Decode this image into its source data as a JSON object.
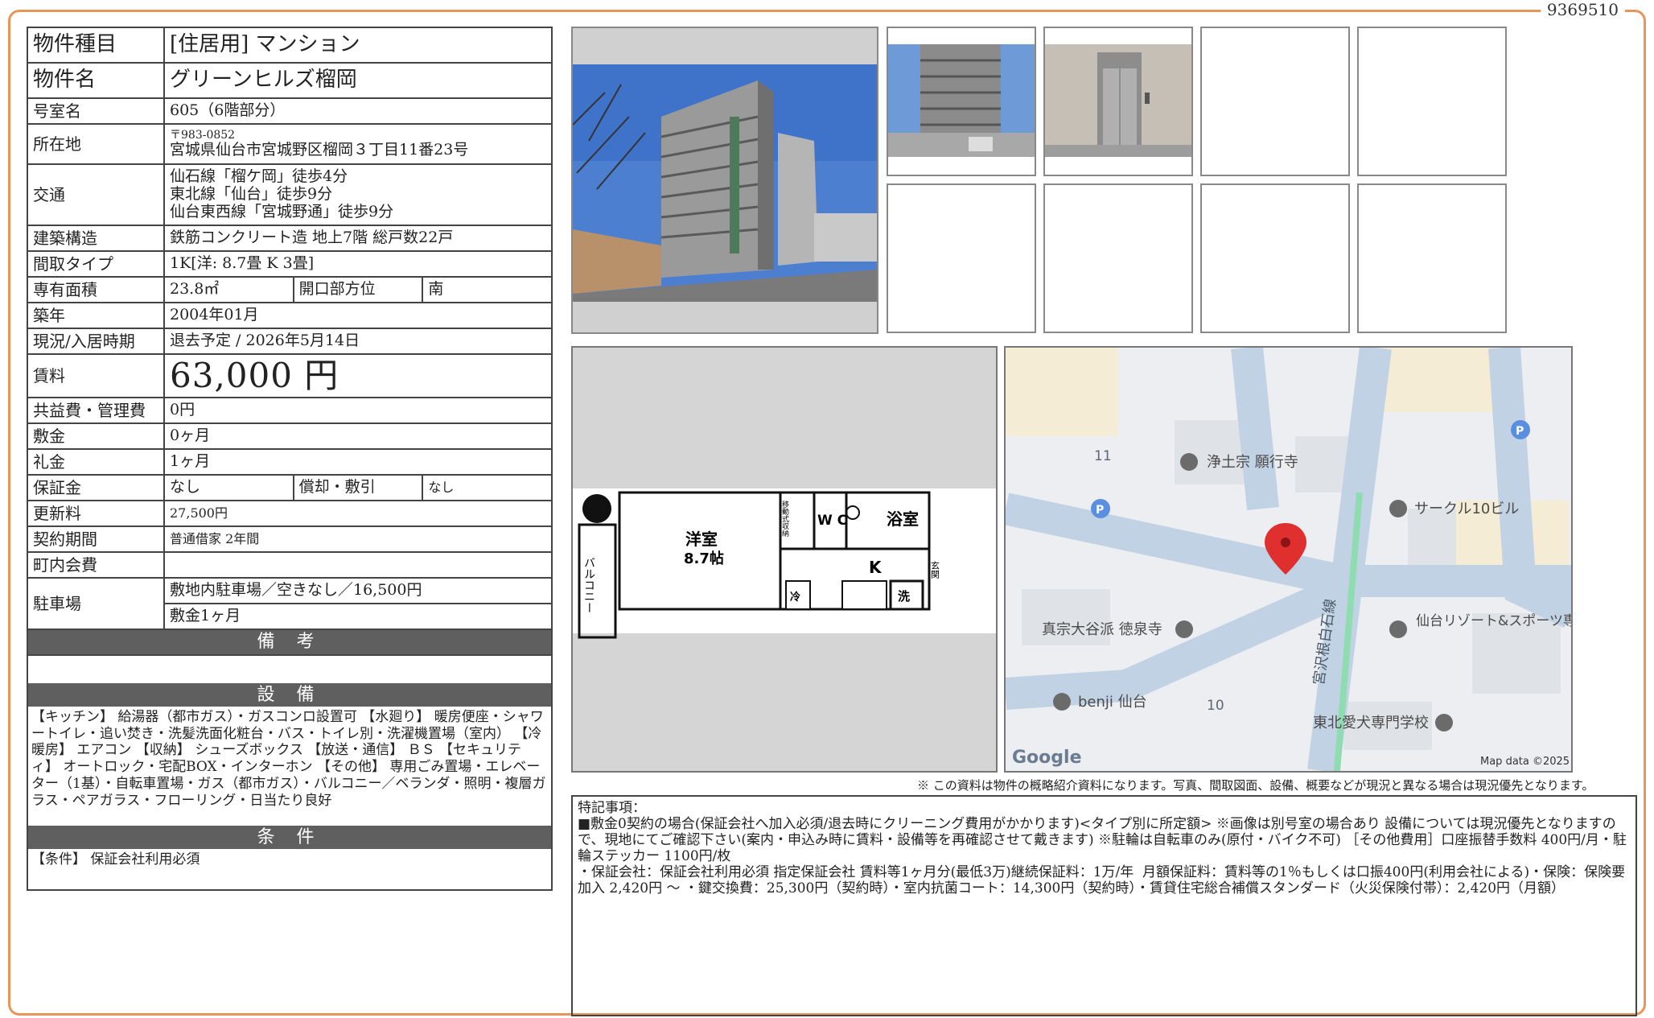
{
  "doc_id": "9369510",
  "property": {
    "type_label": "物件種目",
    "type_value": "[住居用]  マンション",
    "name_label": "物件名",
    "name_value": "グリーンヒルズ榴岡",
    "room_label": "号室名",
    "room_value": "605（6階部分）",
    "address_label": "所在地",
    "postal": "〒983-0852",
    "address": "宮城県仙台市宮城野区榴岡３丁目11番23号",
    "transport_label": "交通",
    "transport": [
      "仙石線「榴ケ岡」徒歩4分",
      "東北線「仙台」徒歩9分",
      "仙台東西線「宮城野通」徒歩9分"
    ],
    "structure_label": "建築構造",
    "structure_value": "鉄筋コンクリート造  地上7階  総戸数22戸",
    "layout_label": "間取タイプ",
    "layout_value": "1K[洋: 8.7畳  K 3畳]",
    "area_label": "専有面積",
    "area_value": "23.8㎡",
    "direction_label": "開口部方位",
    "direction_value": "南",
    "built_label": "築年",
    "built_value": "2004年01月",
    "status_label": "現況/入居時期",
    "status_value": "退去予定  /  2026年5月14日",
    "rent_label": "賃料",
    "rent_value": "63,000 円",
    "fee_label": "共益費・管理費",
    "fee_value": "0円",
    "deposit_label": "敷金",
    "deposit_value": "0ヶ月",
    "key_label": "礼金",
    "key_value": "1ヶ月",
    "guarantee_label": "保証金",
    "guarantee_value": "なし",
    "amort_label": "償却・敷引",
    "amort_value": "なし",
    "renewal_label": "更新料",
    "renewal_value": "27,500円",
    "contract_label": "契約期間",
    "contract_value": "普通借家  2年間",
    "community_label": "町内会費",
    "community_value": "",
    "parking_label": "駐車場",
    "parking_value1": "敷地内駐車場／空きなし／16,500円",
    "parking_value2": "敷金1ヶ月"
  },
  "sections": {
    "remarks_title": "備 考",
    "equip_title": "設 備",
    "equip_text": "【キッチン】 給湯器（都市ガス）・ガスコンロ設置可 【水廻り】 暖房便座・シャワートイレ・追い焚き・洗髪洗面化粧台・バス・トイレ別・洗濯機置場（室内） 【冷暖房】 エアコン 【収納】 シューズボックス 【放送・通信】 ＢＳ 【セキュリティ】 オートロック・宅配BOX・インターホン 【その他】 専用ごみ置場・エレベーター（1基）・自転車置場・ガス（都市ガス）・バルコニー／ベランダ・照明・複層ガラス・ペアガラス・フローリング・日当たり良好",
    "cond_title": "条 件",
    "cond_text": "【条件】 保証会社利用必須"
  },
  "floorplan": {
    "room_name": "洋室",
    "room_size": "8.7帖",
    "wc": "W C",
    "bath": "浴室",
    "kitchen": "K",
    "balcony": "バルコニー",
    "entrance": "玄関",
    "washer": "洗",
    "fridge": "冷",
    "storage": "移動式収納"
  },
  "map": {
    "labels": [
      "浄土宗 願行寺",
      "サークル10ビル",
      "真宗大谷派 徳泉寺",
      "仙台リゾート&スポーツ専門学校",
      "benji 仙台",
      "東北愛犬専門学校",
      "宮沢根白石線",
      "11",
      "10"
    ],
    "google": "Google",
    "map_data": "Map data ©2025",
    "parking": "P"
  },
  "notice": "※ この資料は物件の概略紹介資料になります。写真、間取図面、設備、概要などが現況と異なる場合は現況優先となります。",
  "special": {
    "title": "特記事項：",
    "body": "■敷金0契約の場合(保証会社へ加入必須/退去時にクリーニング費用がかかります)<タイプ別に所定額> ※画像は別号室の場合あり 設備については現況優先となりますので、現地にてご確認下さい(案内・申込み時に賃料・設備等を再確認させて戴きます) ※駐輪は自転車のみ(原付・バイク不可) ［その他費用］口座振替手数料 400円/月・駐輪ステッカー 1100円/枚\n・保証会社：保証会社利用必須 指定保証会社 賃料等1ヶ月分(最低3万)継続保証料：1万/年  月額保証料：賃料等の1％もしくは口振400円(利用会社による)・保険：保険要加入 2,420円 ～ ・鍵交換費：25,300円（契約時）・室内抗菌コート：14,300円（契約時）・賃貸住宅総合補償スタンダード（火災保険付帯）：2,420円（月額）"
  },
  "colors": {
    "frame": "#e8955a",
    "bar": "#5f5f5f"
  }
}
